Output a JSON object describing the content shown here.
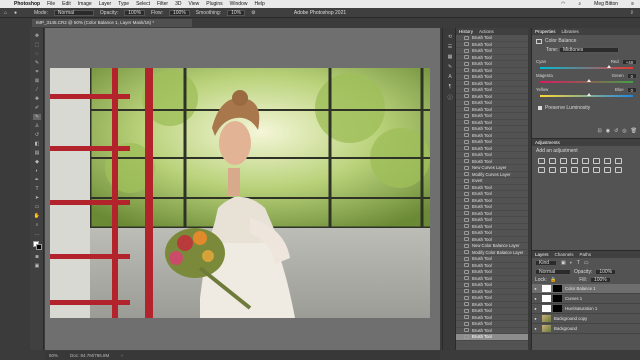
{
  "menubar": {
    "apple": "",
    "items": [
      "Photoshop",
      "File",
      "Edit",
      "Image",
      "Layer",
      "Type",
      "Select",
      "Filter",
      "3D",
      "View",
      "Plugins",
      "Window",
      "Help"
    ],
    "user": "Meg Bitton"
  },
  "window_title": "Adobe Photoshop 2021",
  "options": {
    "mode_label": "Mode:",
    "mode_value": "Normal",
    "opacity_label": "Opacity:",
    "opacity_value": "100%",
    "flow_label": "Flow:",
    "flow_value": "100%",
    "smoothing_label": "Smoothing:",
    "smoothing_value": "10%"
  },
  "doc_tab": "IMP_3145.CR2 @ 50% (Color Balance 1, Layer Mask/16) *",
  "status": {
    "zoom": "50%",
    "doc": "Doc: 84.7M/786.8M"
  },
  "history": {
    "tabs": [
      "History",
      "Actions"
    ],
    "items": [
      "Brush Tool",
      "Brush Tool",
      "Brush Tool",
      "Brush Tool",
      "Brush Tool",
      "Brush Tool",
      "Brush Tool",
      "Brush Tool",
      "Brush Tool",
      "Brush Tool",
      "Brush Tool",
      "Brush Tool",
      "Brush Tool",
      "Brush Tool",
      "Brush Tool",
      "Brush Tool",
      "Brush Tool",
      "Brush Tool",
      "Brush Tool",
      "Brush Tool",
      "New Curves Layer",
      "Modify Curves Layer",
      "Invert",
      "Brush Tool",
      "Brush Tool",
      "Brush Tool",
      "Brush Tool",
      "Brush Tool",
      "Brush Tool",
      "Brush Tool",
      "Brush Tool",
      "Brush Tool",
      "New Color Balance Layer",
      "Modify Color Balance Layer",
      "Brush Tool",
      "Brush Tool",
      "Brush Tool",
      "Brush Tool",
      "Brush Tool",
      "Brush Tool",
      "Brush Tool",
      "Brush Tool",
      "Brush Tool",
      "Brush Tool",
      "Brush Tool",
      "Brush Tool",
      "Brush Tool"
    ],
    "selected_index": 46
  },
  "properties": {
    "tabs": [
      "Properties",
      "Libraries"
    ],
    "title": "Color Balance",
    "tone": "Midtones",
    "sliders": [
      {
        "left": "Cyan",
        "right": "Red",
        "value": "+48",
        "position": 0.72
      },
      {
        "left": "Magenta",
        "right": "Green",
        "value": "0",
        "position": 0.5
      },
      {
        "left": "Yellow",
        "right": "Blue",
        "value": "0",
        "position": 0.5
      }
    ],
    "preserve": "Preserve Luminosity"
  },
  "adjustments": {
    "tab": "Adjustments",
    "subtitle": "Add an adjustment"
  },
  "layers": {
    "tabs": [
      "Layers",
      "Channels",
      "Paths"
    ],
    "kind": "Kind",
    "blend": "Normal",
    "opacity_label": "Opacity:",
    "opacity_value": "100%",
    "lock_label": "Lock:",
    "fill_label": "Fill:",
    "fill_value": "100%",
    "items": [
      {
        "name": "Color Balance 1",
        "selected": true
      },
      {
        "name": "Curves 1",
        "selected": false
      },
      {
        "name": "Hue/Saturation 1",
        "selected": false
      },
      {
        "name": "Background copy",
        "selected": false
      },
      {
        "name": "Background",
        "selected": false
      }
    ]
  },
  "colors": {
    "accent": "#8d8d8d",
    "panel": "#535353",
    "dark": "#3b3b3b",
    "ladder": "#b2232b"
  }
}
